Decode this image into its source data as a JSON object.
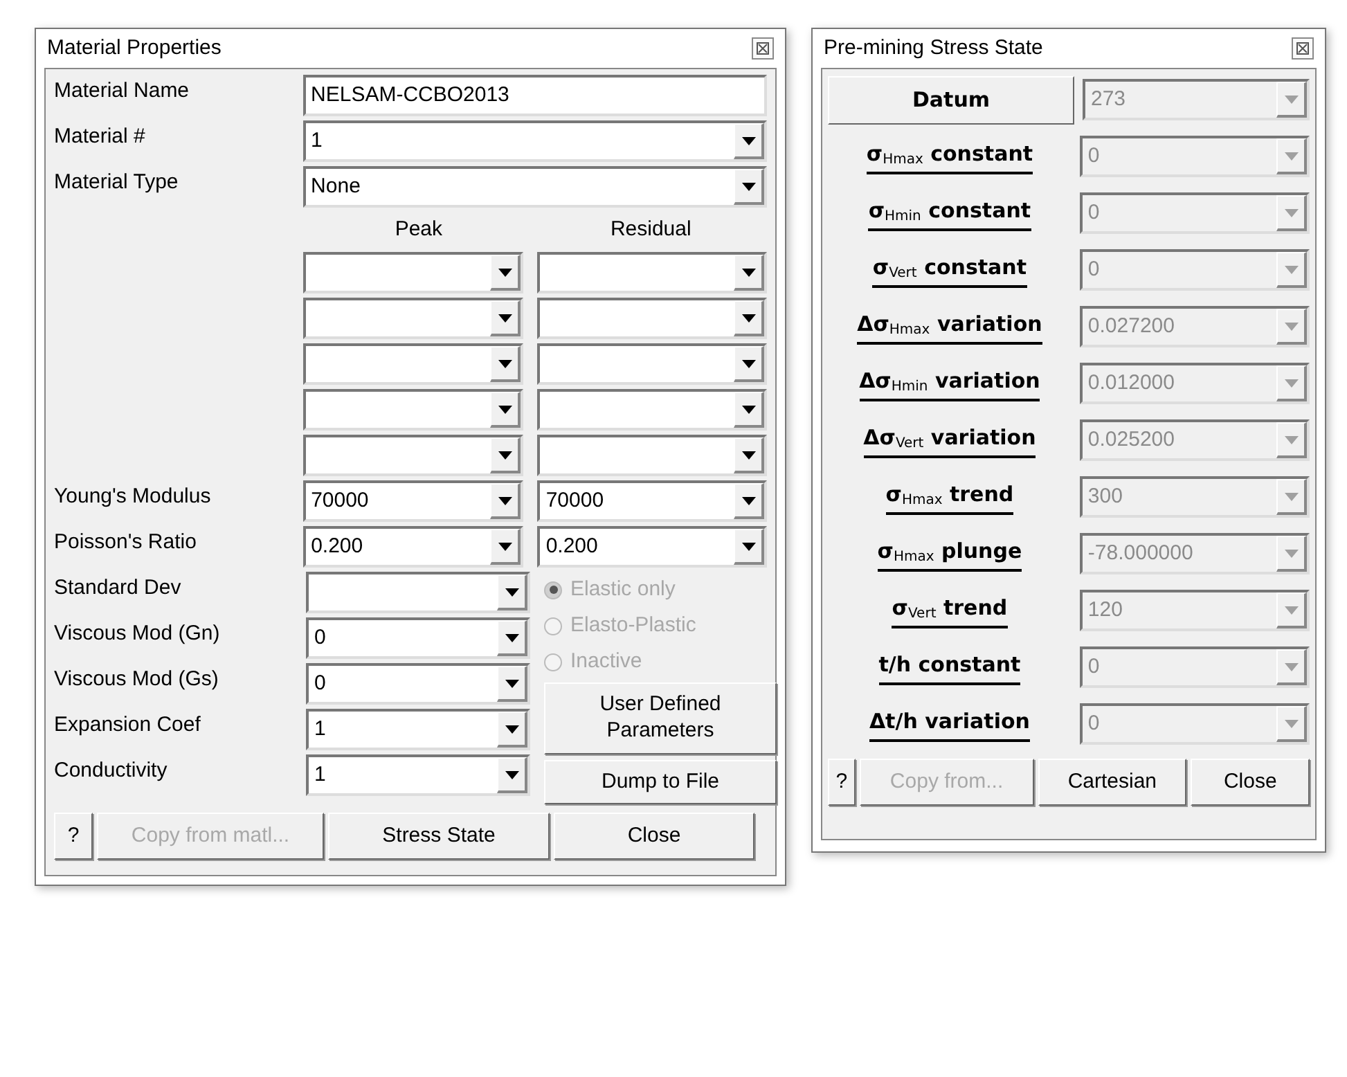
{
  "material_window": {
    "title": "Material Properties",
    "name_field": {
      "label": "Material Name",
      "value": "NELSAM-CCBO2013"
    },
    "top_combos": [
      {
        "label": "Material #",
        "value": "1"
      },
      {
        "label": "Material Type",
        "value": "None"
      }
    ],
    "column_headers": [
      "Peak",
      "Residual"
    ],
    "blank_rows": [
      {
        "kind": "pair"
      },
      {
        "kind": "pair"
      },
      {
        "kind": "pair"
      },
      {
        "kind": "pair"
      },
      {
        "kind": "pair"
      }
    ],
    "pair_rows": [
      {
        "label": "Young's Modulus",
        "peak": "70000",
        "residual": "70000"
      },
      {
        "label": "Poisson's Ratio",
        "peak": "0.200",
        "residual": "0.200"
      }
    ],
    "single_rows": [
      {
        "label": "Standard Dev"
      },
      {
        "label": "Viscous Mod (Gn)",
        "value": "0"
      },
      {
        "label": "Viscous Mod (Gs)",
        "value": "0"
      },
      {
        "label": "Expansion Coef",
        "value": "1"
      },
      {
        "label": "Conductivity",
        "value": "1"
      }
    ],
    "radio_options": [
      {
        "label": "Elastic only",
        "selected": true,
        "disabled": true
      },
      {
        "label": "Elasto-Plastic",
        "selected": false,
        "disabled": true
      },
      {
        "label": "Inactive",
        "selected": false,
        "disabled": true
      }
    ],
    "side_buttons": [
      "User Defined Parameters",
      "Dump to File"
    ],
    "bottom_buttons": [
      {
        "label": "?",
        "disabled": false
      },
      {
        "label": "Copy from matl...",
        "disabled": true
      },
      {
        "label": "Stress State",
        "disabled": false
      },
      {
        "label": "Close",
        "disabled": false
      }
    ]
  },
  "stress_window": {
    "title": "Pre-mining Stress State",
    "rows": [
      {
        "kind": "button",
        "label": "Datum",
        "value": "273"
      },
      {
        "kind": "label",
        "label": "σ$_{Hmax}$ constant",
        "value": "0"
      },
      {
        "kind": "label",
        "label": "σ$_{Hmin}$ constant",
        "value": "0"
      },
      {
        "kind": "label",
        "label": "σ$_{Vert}$ constant",
        "value": "0"
      },
      {
        "kind": "label",
        "label": "Δσ$_{Hmax}$ variation",
        "value": "0.027200"
      },
      {
        "kind": "label",
        "label": "Δσ$_{Hmin}$ variation",
        "value": "0.012000"
      },
      {
        "kind": "label",
        "label": "Δσ$_{Vert}$ variation",
        "value": "0.025200"
      },
      {
        "kind": "label",
        "label": "σ$_{Hmax}$ trend",
        "value": "300"
      },
      {
        "kind": "label",
        "label": "σ$_{Hmax}$ plunge",
        "value": "-78.000000"
      },
      {
        "kind": "label",
        "label": "σ$_{Vert}$ trend",
        "value": "120"
      },
      {
        "kind": "label",
        "label": "t/h constant",
        "value": "0"
      },
      {
        "kind": "label",
        "label": "Δt/h variation",
        "value": "0"
      }
    ],
    "values_disabled": true,
    "bottom_buttons": [
      {
        "label": "?",
        "disabled": false
      },
      {
        "label": "Copy from...",
        "disabled": true
      },
      {
        "label": "Cartesian",
        "disabled": false
      },
      {
        "label": "Close",
        "disabled": false
      }
    ]
  }
}
